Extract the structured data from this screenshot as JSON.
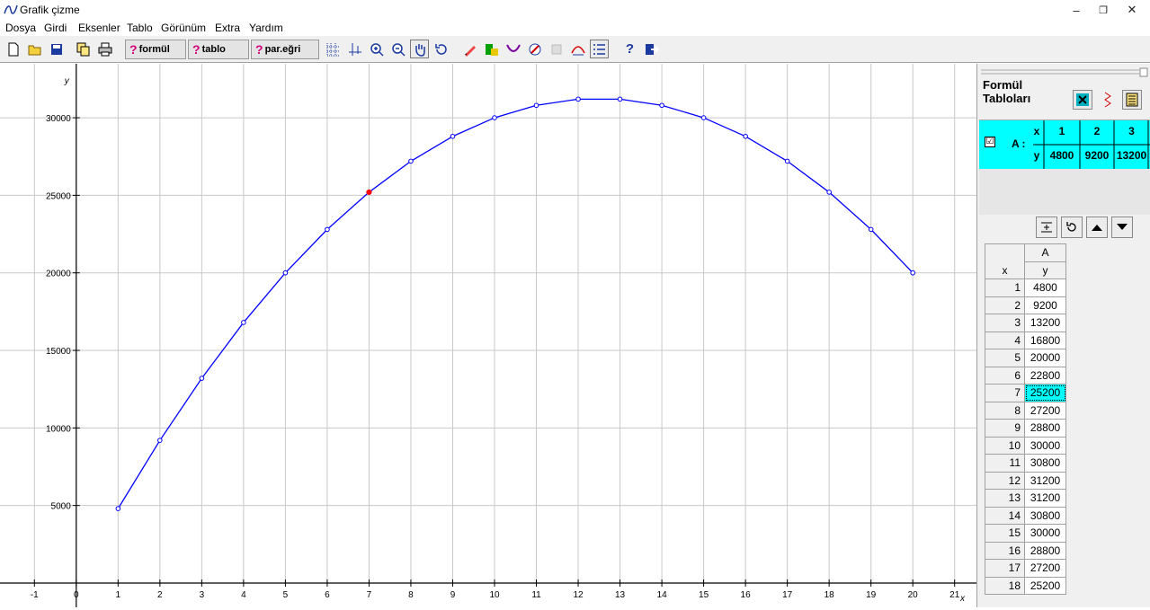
{
  "app": {
    "title": "Grafik çizme"
  },
  "window_controls": {
    "minimize": "–",
    "restore": "❐",
    "close": "✕"
  },
  "menu": [
    "Dosya",
    "Girdi",
    "Eksenler",
    "Tablo",
    "Görünüm",
    "Extra",
    "Yardım"
  ],
  "toolbar": {
    "formul": "formül",
    "tablo": "tablo",
    "paregri": "par.eğri",
    "help": "?"
  },
  "graph": {
    "ylabel": "y",
    "xlabel": "x",
    "highlight_x": 7
  },
  "chart_data": {
    "type": "line",
    "x": [
      1,
      2,
      3,
      4,
      5,
      6,
      7,
      8,
      9,
      10,
      11,
      12,
      13,
      14,
      15,
      16,
      17,
      18,
      19,
      20
    ],
    "series": [
      {
        "name": "A",
        "values": [
          4800,
          9200,
          13200,
          16800,
          20000,
          22800,
          25200,
          27200,
          28800,
          30000,
          30800,
          31200,
          31200,
          30800,
          30000,
          28800,
          27200,
          25200,
          22800,
          20000
        ]
      }
    ],
    "xticks": [
      -1,
      0,
      1,
      2,
      3,
      4,
      5,
      6,
      7,
      8,
      9,
      10,
      11,
      12,
      13,
      14,
      15,
      16,
      17,
      18,
      19,
      20,
      21
    ],
    "yticks": [
      5000,
      10000,
      15000,
      20000,
      25000,
      30000
    ],
    "xlim": [
      -1.35,
      21.35
    ],
    "ylim": [
      0,
      32900
    ],
    "grid": true
  },
  "panel": {
    "title_line1": "Formül",
    "title_line2": "Tabloları",
    "checkbox": "☑",
    "formula_label": "A :",
    "ftable_header": {
      "x": "x",
      "y": "y",
      "cols": [
        "1",
        "2",
        "3"
      ],
      "vals": [
        "4800",
        "9200",
        "13200"
      ]
    },
    "vtable": {
      "col_name": "A",
      "x_header": "x",
      "y_header": "y",
      "rows": [
        {
          "x": "1",
          "y": "4800"
        },
        {
          "x": "2",
          "y": "9200"
        },
        {
          "x": "3",
          "y": "13200"
        },
        {
          "x": "4",
          "y": "16800"
        },
        {
          "x": "5",
          "y": "20000"
        },
        {
          "x": "6",
          "y": "22800"
        },
        {
          "x": "7",
          "y": "25200"
        },
        {
          "x": "8",
          "y": "27200"
        },
        {
          "x": "9",
          "y": "28800"
        },
        {
          "x": "10",
          "y": "30000"
        },
        {
          "x": "11",
          "y": "30800"
        },
        {
          "x": "12",
          "y": "31200"
        },
        {
          "x": "13",
          "y": "31200"
        },
        {
          "x": "14",
          "y": "30800"
        },
        {
          "x": "15",
          "y": "30000"
        },
        {
          "x": "16",
          "y": "28800"
        },
        {
          "x": "17",
          "y": "27200"
        },
        {
          "x": "18",
          "y": "25200"
        }
      ],
      "selected_row": 6
    }
  },
  "colors": {
    "curve": "#0000ff",
    "highlight": "#ff0000",
    "grid": "#c8c8c8",
    "cyan": "#00ffff"
  }
}
